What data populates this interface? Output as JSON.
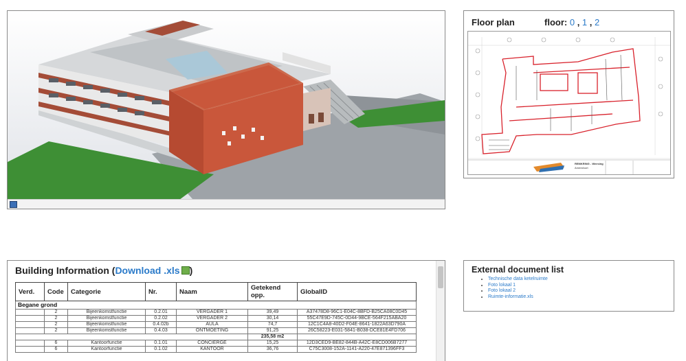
{
  "floorplan": {
    "title": "Floor plan",
    "floor_label": "floor:",
    "floors": [
      "0",
      "1",
      "2"
    ],
    "title_block": {
      "project": "REMKRING - Weesing",
      "location": "Amersfoort"
    }
  },
  "building_info": {
    "title": "Building Information",
    "download_label": "Download .xls",
    "columns": [
      "Verd.",
      "Code",
      "Categorie",
      "Nr.",
      "Naam",
      "Getekend opp.",
      "GlobalID"
    ],
    "group": "Begane grond",
    "rows": [
      {
        "verd": "",
        "code": "2",
        "cat": "Bijeenkomstfunctie",
        "nr": "0.2.01",
        "naam": "VERGADER 1",
        "opp": "39,49",
        "gid": "A37478D8-96C1-E04C-8BFD-B25CA08C0D45"
      },
      {
        "verd": "",
        "code": "2",
        "cat": "Bijeenkomstfunctie",
        "nr": "0.2.02",
        "naam": "VERGADER 2",
        "opp": "30,14",
        "gid": "55C47E9D-745C-0D44-9BCE-564F215ABA20"
      },
      {
        "verd": "",
        "code": "2",
        "cat": "Bijeenkomstfunctie",
        "nr": "0.4.02b",
        "naam": "AULA",
        "opp": "74,7",
        "gid": "12C1C4A8-40D2-F04E-8641-1822A63D790A"
      },
      {
        "verd": "",
        "code": "2",
        "cat": "Bijeenkomstfunctie",
        "nr": "0.4.03",
        "naam": "ONTMOETING",
        "opp": "91,25",
        "gid": "26C58223-E031-5841-B038-DCE81E4FD706"
      }
    ],
    "subtotal": "235,58 m2",
    "rows2": [
      {
        "verd": "",
        "code": "6",
        "cat": "Kantoorfunctie",
        "nr": "0.1.01",
        "naam": "CONCIERGE",
        "opp": "15,25",
        "gid": "12D3CED9-BE82-844B-A42C-E8CD006B7277"
      },
      {
        "verd": "",
        "code": "6",
        "cat": "Kantoorfunctie",
        "nr": "0.1.02",
        "naam": "KANTOOR",
        "opp": "36,76",
        "gid": "C75C3008-152A-1141-A220-47E871396FF3"
      }
    ]
  },
  "external_docs": {
    "title": "External document list",
    "items": [
      "Technische data ketelruimte",
      "Foto lokaal 1",
      "Foto lokaal 2",
      "Ruimte-informatie.xls"
    ]
  },
  "colors": {
    "link": "#2a7ac9",
    "brick": "#c9573b",
    "grass": "#3e8f35",
    "plan_red": "#d8202a"
  }
}
